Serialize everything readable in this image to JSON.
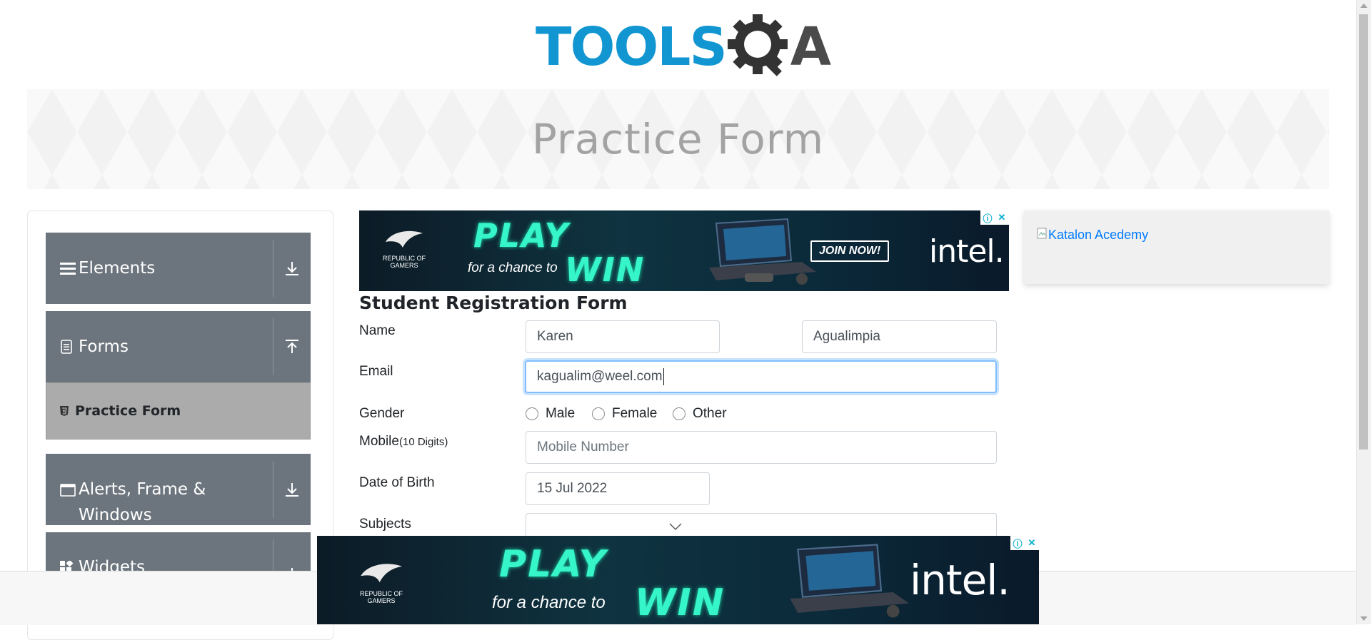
{
  "logo": {
    "part1": "TOOLS",
    "part2": "A",
    "icon": "gear-magnifier-icon"
  },
  "page": {
    "title": "Practice Form"
  },
  "sidebar": {
    "groups": [
      {
        "label": "Elements",
        "icon": "hamburger-icon",
        "toggle_icon": "download-icon"
      },
      {
        "label": "Forms",
        "icon": "document-icon",
        "toggle_icon": "upload-icon"
      },
      {
        "label": "Alerts, Frame & Windows",
        "label_line1": "Alerts, Frame &",
        "label_line2": "Windows",
        "icon": "window-icon",
        "toggle_icon": "download-icon"
      },
      {
        "label": "Widgets",
        "icon": "widgets-icon",
        "toggle_icon": "download-icon"
      }
    ],
    "active_item": {
      "label": "Practice Form",
      "icon": "html5-icon"
    }
  },
  "ads": {
    "top": {
      "brand": "REPUBLIC OF GAMERS",
      "headline1": "PLAY",
      "tagline": "for a chance to",
      "headline2": "WIN",
      "cta": "JOIN NOW!",
      "logo": "intel."
    },
    "bottom": {
      "brand": "REPUBLIC OF GAMERS",
      "headline1": "PLAY",
      "tagline": "for a chance to",
      "headline2": "WIN",
      "logo": "intel."
    },
    "info_icon": "ⓘ",
    "close_icon": "✕"
  },
  "side_card": {
    "image_alt": "Katalon Acedemy"
  },
  "form": {
    "title": "Student Registration Form",
    "name_label": "Name",
    "first_name": "Karen",
    "last_name": "Agualimpia",
    "email_label": "Email",
    "email_value": "kagualim@weel.com",
    "gender_label": "Gender",
    "gender_options": [
      "Male",
      "Female",
      "Other"
    ],
    "mobile_label": "Mobile",
    "mobile_hint": "(10 Digits)",
    "mobile_placeholder": "Mobile Number",
    "dob_label": "Date of Birth",
    "dob_value": "15 Jul 2022",
    "subjects_label": "Subjects"
  },
  "colors": {
    "brand_blue": "#1196d1",
    "sidebar_gray": "#6c757d",
    "active_gray": "#ababab",
    "link_blue": "#007bff",
    "focus_blue": "#80bdff"
  }
}
